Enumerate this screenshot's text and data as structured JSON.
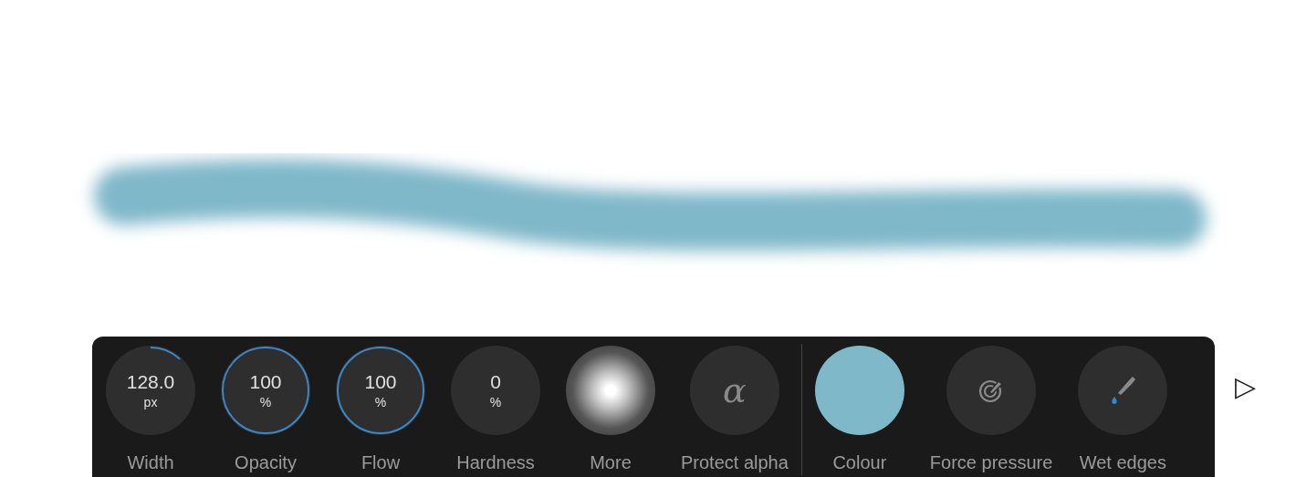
{
  "controls": [
    {
      "kind": "dial",
      "value": "128.0",
      "unit": "px",
      "level": 0.12,
      "label": "Width"
    },
    {
      "kind": "dial",
      "value": "100",
      "unit": "%",
      "level": 1,
      "label": "Opacity"
    },
    {
      "kind": "dial",
      "value": "100",
      "unit": "%",
      "level": 1,
      "label": "Flow"
    },
    {
      "kind": "dial",
      "value": "0",
      "unit": "%",
      "label": "Hardness"
    },
    {
      "kind": "brush",
      "label": "More"
    },
    {
      "kind": "alpha",
      "symbol": "α",
      "label": "Protect alpha"
    },
    {
      "kind": "separator"
    },
    {
      "kind": "color",
      "color": "#7fb8c9",
      "label": "Colour"
    },
    {
      "kind": "pressure",
      "label": "Force pressure"
    },
    {
      "kind": "wet",
      "label": "Wet edges"
    }
  ],
  "play_button": "▷"
}
